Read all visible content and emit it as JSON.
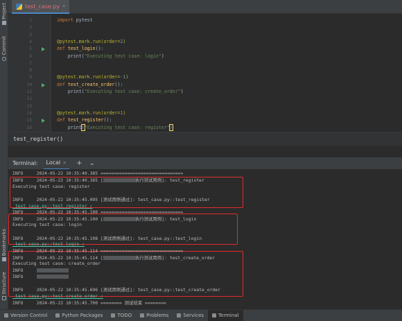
{
  "left_strip": {
    "project": "Project",
    "commit": "Commit",
    "bookmarks": "Bookmarks",
    "structure": "Structure"
  },
  "editor": {
    "tab_name": "test_case.py",
    "tab_close": "×",
    "line_numbers": [
      "1",
      "2",
      "3",
      "4",
      "5",
      "6",
      "7",
      "8",
      "9",
      "10",
      "11",
      "12",
      "13",
      "14",
      "15",
      "16"
    ],
    "run_marker_lines": [
      5,
      10,
      15
    ]
  },
  "code_lines": [
    [
      {
        "t": "import",
        "c": "kw"
      },
      {
        "t": " pytest",
        "c": ""
      }
    ],
    [],
    [],
    [
      {
        "t": "@pytest.mark.run(order=",
        "c": "dec"
      },
      {
        "t": "2",
        "c": "num"
      },
      {
        "t": ")",
        "c": "dec"
      }
    ],
    [
      {
        "t": "def ",
        "c": "kw"
      },
      {
        "t": "test_login",
        "c": "fn"
      },
      {
        "t": "():",
        "c": ""
      }
    ],
    [
      {
        "t": "    print(",
        "c": ""
      },
      {
        "t": "\"Executing test case: login\"",
        "c": "str"
      },
      {
        "t": ")",
        "c": ""
      }
    ],
    [],
    [],
    [
      {
        "t": "@pytest.mark.run(order=",
        "c": "dec"
      },
      {
        "t": "-1",
        "c": "num"
      },
      {
        "t": ")",
        "c": "dec"
      }
    ],
    [
      {
        "t": "def ",
        "c": "kw"
      },
      {
        "t": "test_create_order",
        "c": "fn"
      },
      {
        "t": "():",
        "c": ""
      }
    ],
    [
      {
        "t": "    print(",
        "c": ""
      },
      {
        "t": "\"Executing test case: create_order\"",
        "c": "str"
      },
      {
        "t": ")",
        "c": ""
      }
    ],
    [],
    [],
    [
      {
        "t": "@pytest.mark.run(order=",
        "c": "dec"
      },
      {
        "t": "1",
        "c": "num"
      },
      {
        "t": ")",
        "c": "dec"
      }
    ],
    [
      {
        "t": "def ",
        "c": "kw"
      },
      {
        "t": "test_register",
        "c": "fn"
      },
      {
        "t": "():",
        "c": ""
      }
    ],
    [
      {
        "t": "    print",
        "c": ""
      },
      {
        "t": "(",
        "c": "hl"
      },
      {
        "t": "\"Executing test case: register\"",
        "c": "str"
      },
      {
        "t": ")",
        "c": "hl"
      },
      {
        "t": "|caret|",
        "c": "caret"
      }
    ]
  ],
  "breadcrumb": "test_register()",
  "terminal": {
    "label": "Terminal:",
    "tab": "Local",
    "tab_close": "×",
    "new_tab": "+",
    "dropdown": "⌄"
  },
  "terminal_lines": [
    {
      "text": "INFO     2024-05-22 10:35:40.385 ===============================",
      "blur": false,
      "cls": ""
    },
    {
      "text": "INFO     2024-05-22 10:35:40.385 [",
      "blur": true,
      "after": "执行测试用例]: test_register",
      "cls": ""
    },
    {
      "text": "Executing test case: register",
      "blur": false,
      "cls": ""
    },
    {
      "text": "",
      "blur": false,
      "cls": ""
    },
    {
      "text": "INFO     2024-05-22 10:35:45.095 [测试用例通过]: test_case.py::test_register",
      "blur": false,
      "cls": ""
    },
    {
      "text": " test_case.py::test_register ✓",
      "blur": false,
      "cls": "ok"
    },
    {
      "text": "INFO     2024-05-22 10:35:45.100 ===============================",
      "blur": false,
      "cls": ""
    },
    {
      "text": "INFO     2024-05-22 10:35:45.100 [",
      "blur": true,
      "after": "执行测试用例]: test_login",
      "cls": ""
    },
    {
      "text": "Executing test case: login",
      "blur": false,
      "cls": ""
    },
    {
      "text": "",
      "blur": false,
      "cls": ""
    },
    {
      "text": "INFO     2024-05-22 10:35:45.108 [测试用例通过]: test_case.py::test_login",
      "blur": false,
      "cls": ""
    },
    {
      "text": " test_case.py::test_login ✓",
      "blur": false,
      "cls": "ok"
    },
    {
      "text": "INFO     2024-05-22 10:35:45.114 ===============================",
      "blur": false,
      "cls": ""
    },
    {
      "text": "INFO     2024-05-22 10:35:45.114 [",
      "blur": true,
      "after": "执行测试用例]: test_create_order",
      "cls": ""
    },
    {
      "text": "Executing test case: create_order",
      "blur": false,
      "cls": ""
    },
    {
      "text": "INFO     ",
      "blur": true,
      "after": "",
      "cls": ""
    },
    {
      "text": "INFO     ",
      "blur": true,
      "after": "",
      "cls": ""
    },
    {
      "text": "",
      "blur": false,
      "cls": ""
    },
    {
      "text": "INFO     2024-05-22 10:35:45.696 [测试用例通过]: test_case.py::test_create_order",
      "blur": false,
      "cls": ""
    },
    {
      "text": " test_case.py::test_create_order ✓",
      "blur": false,
      "cls": "ok"
    },
    {
      "text": "INFO     2024-05-22 10:35:45.700 ======== 测试结束 ========",
      "blur": false,
      "cls": ""
    }
  ],
  "status_bar": [
    {
      "label": "Version Control",
      "icon": "branch-icon",
      "active": false
    },
    {
      "label": "Python Packages",
      "icon": "packages-icon",
      "active": false
    },
    {
      "label": "TODO",
      "icon": "todo-icon",
      "active": false
    },
    {
      "label": "Problems",
      "icon": "problems-icon",
      "active": false
    },
    {
      "label": "Services",
      "icon": "services-icon",
      "active": false
    },
    {
      "label": "Terminal",
      "icon": "terminal-icon",
      "active": true
    }
  ],
  "colors": {
    "editor_bg": "#2b2b2b",
    "keyword": "#cc7832",
    "function": "#ffc66d",
    "decorator": "#bbb529",
    "string": "#6a8759",
    "number": "#6897bb",
    "highlight_box": "#e52b2b"
  }
}
